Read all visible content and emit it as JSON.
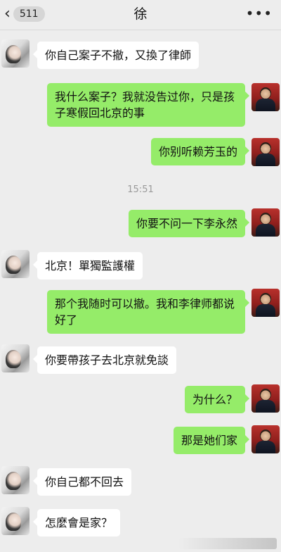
{
  "header": {
    "back_icon": "chevron-left-icon",
    "unread_count": "511",
    "title": "徐",
    "more_icon": "ellipsis-icon"
  },
  "timestamp": "15:51",
  "messages": [
    {
      "side": "left",
      "text": "你自己案子不撤，又換了律師"
    },
    {
      "side": "right",
      "text": "我什么案子？我就没告过你，只是孩子寒假回北京的事"
    },
    {
      "side": "right",
      "text": "你别听赖芳玉的"
    },
    {
      "side": "right",
      "text": "你要不问一下李永然"
    },
    {
      "side": "left",
      "text": "北京！單獨監護權"
    },
    {
      "side": "right",
      "text": "那个我随时可以撤。我和李律师都说好了"
    },
    {
      "side": "left",
      "text": "你要帶孩子去北京就免談"
    },
    {
      "side": "right",
      "text": "为什么？"
    },
    {
      "side": "right",
      "text": "那是她们家"
    },
    {
      "side": "left",
      "text": "你自己都不回去"
    },
    {
      "side": "left",
      "text": "怎麼會是家？"
    }
  ],
  "colors": {
    "background": "#ededed",
    "sent_bubble": "#95ec69",
    "received_bubble": "#ffffff",
    "timestamp_text": "#9a9a9a"
  }
}
